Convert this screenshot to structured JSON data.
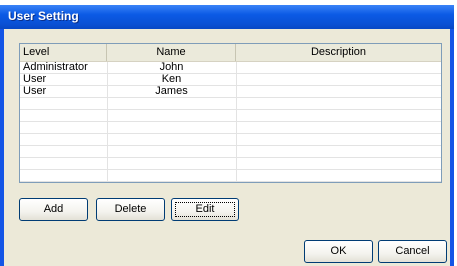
{
  "window": {
    "title": "User Setting"
  },
  "table": {
    "columns": [
      "Level",
      "Name",
      "Description"
    ],
    "rows": [
      {
        "level": "Administrator",
        "name": "John",
        "description": ""
      },
      {
        "level": "User",
        "name": "Ken",
        "description": ""
      },
      {
        "level": "User",
        "name": "James",
        "description": ""
      }
    ],
    "empty_row_count": 7
  },
  "buttons": {
    "add": "Add",
    "delete": "Delete",
    "edit": "Edit",
    "ok": "OK",
    "cancel": "Cancel"
  },
  "colors": {
    "titlebar": "#0b5ae5",
    "dialog_face": "#ece9d8",
    "button_border": "#003c74"
  }
}
